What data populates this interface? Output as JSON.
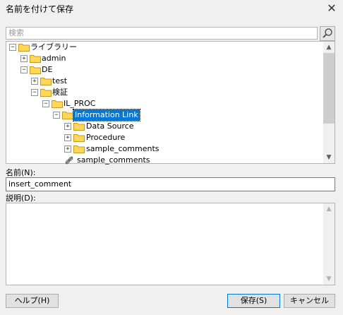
{
  "dialog": {
    "title": "名前を付けて保存",
    "close_glyph": "✕"
  },
  "search": {
    "placeholder": "検索"
  },
  "tree": {
    "items": [
      {
        "label": "ライブラリー",
        "expander": "−"
      },
      {
        "label": "admin",
        "expander": "+"
      },
      {
        "label": "DE",
        "expander": "−"
      },
      {
        "label": "test",
        "expander": "+"
      },
      {
        "label": "検証",
        "expander": "−"
      },
      {
        "label": "IL_PROC",
        "expander": "−"
      },
      {
        "label": "Information Link",
        "expander": "−"
      },
      {
        "label": "Data Source",
        "expander": "+"
      },
      {
        "label": "Procedure",
        "expander": "+"
      },
      {
        "label": "sample_comments",
        "expander": "+"
      },
      {
        "label": "sample_comments"
      }
    ]
  },
  "name_field": {
    "label": "名前(N):",
    "value": "insert_comment"
  },
  "description_field": {
    "label": "説明(D):",
    "value": ""
  },
  "buttons": {
    "help": "ヘルプ(H)",
    "save": "保存(S)",
    "cancel": "キャンセル"
  },
  "scroll_up_glyph": "▲",
  "scroll_down_glyph": "▼",
  "colors": {
    "selection": "#0078d7",
    "folder": "#ffd75a",
    "folder_border": "#c89a1a"
  }
}
